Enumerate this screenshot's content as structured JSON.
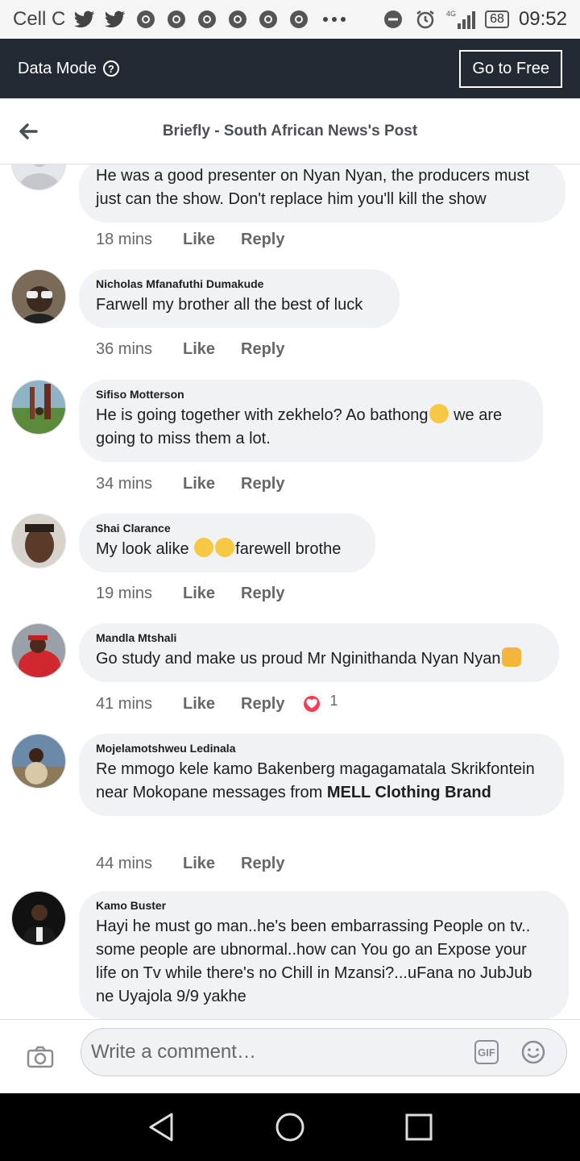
{
  "status": {
    "carrier": "Cell C",
    "network": "4G",
    "battery": "68",
    "time": "09:52"
  },
  "data_bar": {
    "label": "Data Mode",
    "button": "Go to Free"
  },
  "header": {
    "title": "Briefly - South African News's Post"
  },
  "actions": {
    "like": "Like",
    "reply": "Reply"
  },
  "comments": [
    {
      "author": "",
      "text": "He was a good presenter on Nyan Nyan, the producers must just can the show. Don't replace him you'll kill the show",
      "time": "18 mins"
    },
    {
      "author": "Nicholas Mfanafuthi Dumakude",
      "text": "Farwell my brother all the best of luck",
      "time": "36 mins"
    },
    {
      "author": "Sifiso Motterson",
      "text_before": "He is going together with zekhelo? Ao bathong",
      "text_after": " we are going to miss them a lot.",
      "time": "34 mins"
    },
    {
      "author": "Shai Clarance",
      "text_before": "My look alike ",
      "text_after": "farewell brothe",
      "time": "19 mins"
    },
    {
      "author": "Mandla Mtshali",
      "text": "Go study and make us proud Mr Nginithanda Nyan Nyan",
      "time": "41 mins",
      "reaction_count": "1"
    },
    {
      "author": "Mojelamotshweu Ledinala",
      "text": " Re mmogo kele kamo Bakenberg magagamatala Skrikfontein near Mokopane messages from ",
      "bold": "MELL Clothing Brand",
      "time": "44 mins"
    },
    {
      "author": "Kamo Buster",
      "text": "Hayi he must go man..he's been embarrassing People on tv.. some people are ubnormal..how can You go an Expose your life on Tv while there's no Chill in Mzansi?...uFana no JubJub ne Uyajola 9/9 yakhe"
    }
  ],
  "composer": {
    "placeholder": "Write a comment…",
    "gif": "GIF"
  },
  "colors": {
    "header_bg": "#232a34",
    "bubble_bg": "#f0f2f5",
    "heart": "#f33e58"
  }
}
